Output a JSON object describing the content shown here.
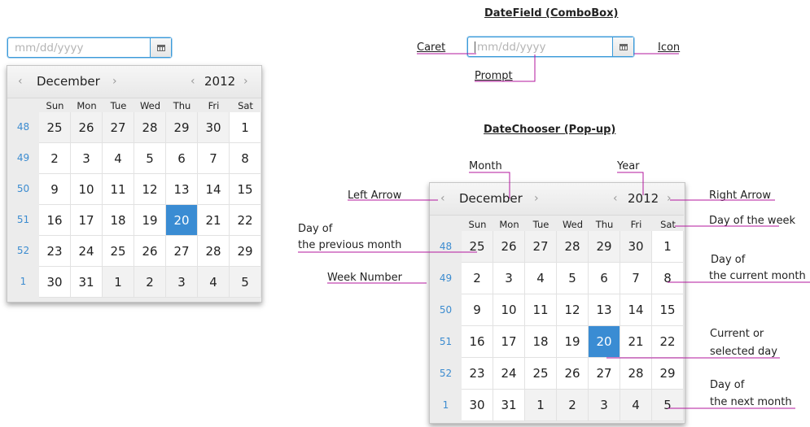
{
  "titles": {
    "datefield": "DateField (ComboBox)",
    "datechooser": "DateChooser (Pop-up)"
  },
  "combo": {
    "placeholder": "mm/dd/yyyy",
    "icon": "calendar-icon"
  },
  "calendar": {
    "month": "December",
    "year": "2012",
    "prev_arrow": "‹",
    "next_arrow": "›",
    "weekdays": [
      "Sun",
      "Mon",
      "Tue",
      "Wed",
      "Thu",
      "Fri",
      "Sat"
    ],
    "week_numbers": [
      "48",
      "49",
      "50",
      "51",
      "52",
      "1"
    ],
    "weeks": [
      [
        "25",
        "26",
        "27",
        "28",
        "29",
        "30",
        "1"
      ],
      [
        "2",
        "3",
        "4",
        "5",
        "6",
        "7",
        "8"
      ],
      [
        "9",
        "10",
        "11",
        "12",
        "13",
        "14",
        "15"
      ],
      [
        "16",
        "17",
        "18",
        "19",
        "20",
        "21",
        "22"
      ],
      [
        "23",
        "24",
        "25",
        "26",
        "27",
        "28",
        "29"
      ],
      [
        "30",
        "31",
        "1",
        "2",
        "3",
        "4",
        "5"
      ]
    ],
    "current_month_flags": [
      [
        false,
        false,
        false,
        false,
        false,
        false,
        true
      ],
      [
        true,
        true,
        true,
        true,
        true,
        true,
        true
      ],
      [
        true,
        true,
        true,
        true,
        true,
        true,
        true
      ],
      [
        true,
        true,
        true,
        true,
        true,
        true,
        true
      ],
      [
        true,
        true,
        true,
        true,
        true,
        true,
        true
      ],
      [
        true,
        true,
        false,
        false,
        false,
        false,
        false
      ]
    ],
    "selected": {
      "row": 3,
      "col": 4
    },
    "selected_color": "#3a8cd3",
    "week_number_color": "#3c8cd0"
  },
  "annotations": {
    "caret": "Caret",
    "icon": "Icon",
    "prompt": "Prompt",
    "month": "Month",
    "year": "Year",
    "left_arrow": "Left Arrow",
    "right_arrow": "Right Arrow",
    "day_of_week": "Day of the week",
    "prev_month_line1": "Day of",
    "prev_month_line2": "the previous month",
    "week_number": "Week Number",
    "cur_month_line1": "Day of",
    "cur_month_line2": "the current month",
    "selected_line1": "Current or",
    "selected_line2": "selected day",
    "next_month_line1": "Day of",
    "next_month_line2": "the next month",
    "line_color": "#b3179e"
  }
}
